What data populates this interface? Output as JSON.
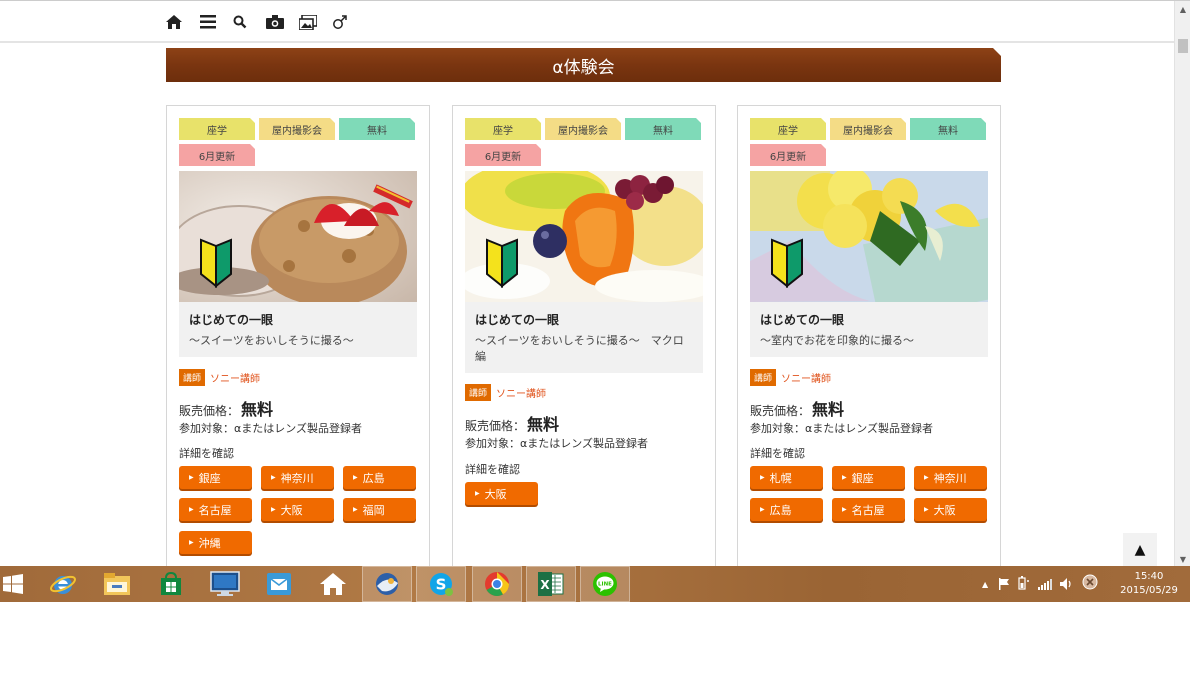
{
  "nav": {
    "icons": [
      "home-icon",
      "menu-icon",
      "search-icon",
      "camera-icon",
      "gallery-icon",
      "gender-icon"
    ]
  },
  "banner": {
    "title": "α体験会"
  },
  "cards": [
    {
      "tags": [
        "座学",
        "屋内撮影会",
        "無料",
        "6月更新"
      ],
      "title": "はじめての一眼",
      "subtitle": "～スイーツをおいしそうに撮る～",
      "instructor_badge": "講師",
      "instructor_name": "ソニー講師",
      "price_label": "販売価格：",
      "price_value": "無料",
      "target": "参加対象：αまたはレンズ製品登録者",
      "detail": "詳細を確認",
      "locations": [
        "銀座",
        "神奈川",
        "広島",
        "名古屋",
        "大阪",
        "福岡",
        "沖縄"
      ]
    },
    {
      "tags": [
        "座学",
        "屋内撮影会",
        "無料",
        "6月更新"
      ],
      "title": "はじめての一眼",
      "subtitle": "～スイーツをおいしそうに撮る～　マクロ編",
      "instructor_badge": "講師",
      "instructor_name": "ソニー講師",
      "price_label": "販売価格：",
      "price_value": "無料",
      "target": "参加対象：αまたはレンズ製品登録者",
      "detail": "詳細を確認",
      "locations": [
        "大阪"
      ]
    },
    {
      "tags": [
        "座学",
        "屋内撮影会",
        "無料",
        "6月更新"
      ],
      "title": "はじめての一眼",
      "subtitle": "～室内でお花を印象的に撮る～",
      "instructor_badge": "講師",
      "instructor_name": "ソニー講師",
      "price_label": "販売価格：",
      "price_value": "無料",
      "target": "参加対象：αまたはレンズ製品登録者",
      "detail": "詳細を確認",
      "locations": [
        "札幌",
        "銀座",
        "神奈川",
        "広島",
        "名古屋",
        "大阪"
      ]
    }
  ],
  "totop": {
    "label": "▲"
  },
  "taskbar": {
    "apps": [
      "windows-start-icon",
      "internet-explorer-icon",
      "file-explorer-icon",
      "store-icon",
      "lenovo-monitor-icon",
      "mail-icon",
      "home-app-icon",
      "thunderbird-icon",
      "skype-icon",
      "chrome-icon",
      "excel-icon",
      "line-icon"
    ],
    "time": "15:40",
    "date": "2015/05/29"
  },
  "colors": {
    "banner": "#7a3510",
    "tag_yellow": "#e8e26a",
    "tag_beige": "#f4dc86",
    "tag_green": "#7fdab8",
    "tag_pink": "#f5a3a3",
    "button_orange": "#f06a00",
    "instructor_badge": "#e06a00"
  }
}
